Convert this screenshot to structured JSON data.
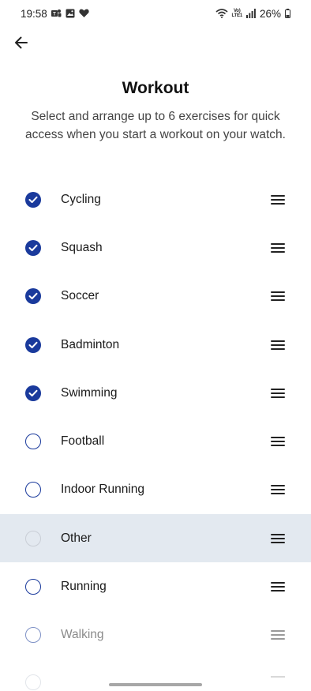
{
  "status_bar": {
    "time": "19:58",
    "left_icons": [
      "teams-icon",
      "gallery-icon",
      "heart-icon"
    ],
    "lte_label_top": "Vo)",
    "lte_label_bottom": "LTE1",
    "battery": "26%"
  },
  "header": {
    "title": "Workout",
    "subtitle": "Select and arrange up to 6 exercises for quick access when you start a workout on your watch."
  },
  "exercises": [
    {
      "label": "Cycling",
      "checked": true
    },
    {
      "label": "Squash",
      "checked": true
    },
    {
      "label": "Soccer",
      "checked": true
    },
    {
      "label": "Badminton",
      "checked": true
    },
    {
      "label": "Swimming",
      "checked": true
    },
    {
      "label": "Football",
      "checked": false
    },
    {
      "label": "Indoor Running",
      "checked": false
    },
    {
      "label": "Other",
      "checked": false,
      "state": "being-dragged"
    },
    {
      "label": "Running",
      "checked": false
    },
    {
      "label": "Walking",
      "checked": false,
      "state": "faded"
    }
  ],
  "colors": {
    "accent": "#1a3a9c",
    "highlight_row": "#e3e9f0"
  }
}
